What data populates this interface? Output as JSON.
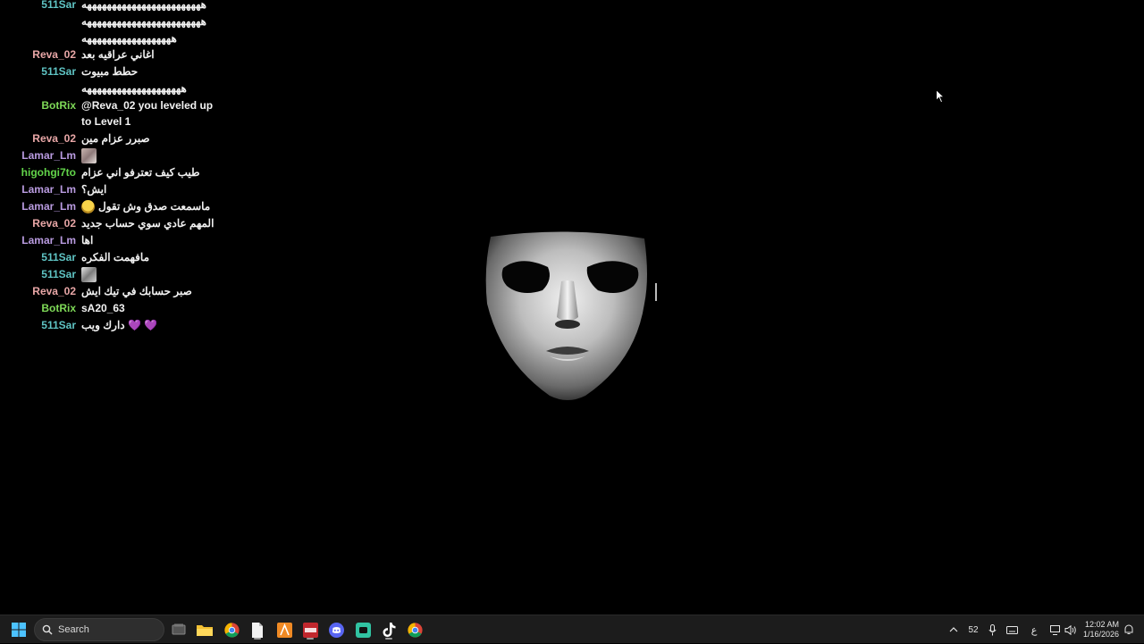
{
  "chat": {
    "messages": [
      {
        "user": "511Sar",
        "color": "#5fc4c4",
        "text": "ههههههههههههههههههههههههه"
      },
      {
        "user": "",
        "color": "#5fc4c4",
        "text": "ههههههههههههههههههههههههه"
      },
      {
        "user": "",
        "color": "#5fc4c4",
        "text": "ههههههههههههههههههه"
      },
      {
        "user": "Reva_02",
        "color": "#e9a7a7",
        "text": "اغاني عراقيه بعد"
      },
      {
        "user": "511Sar",
        "color": "#5fc4c4",
        "text": "حطط مبيوت"
      },
      {
        "user": "",
        "color": "#5fc4c4",
        "text": "ههههههههههههههههههههه"
      },
      {
        "user": "BotRix",
        "color": "#7ed957",
        "text": "@Reva_02 you leveled up to Level 1"
      },
      {
        "user": "Reva_02",
        "color": "#e9a7a7",
        "text": "صبرر عزام مين"
      },
      {
        "user": "Lamar_Lm",
        "color": "#b99be0",
        "text": "",
        "emote": "photo-emote"
      },
      {
        "user": "higohgi7to",
        "color": "#62d44a",
        "text": "طيب كيف تعترفو اني عزام"
      },
      {
        "user": "Lamar_Lm",
        "color": "#b99be0",
        "text": "ايش؟"
      },
      {
        "user": "Lamar_Lm",
        "color": "#b99be0",
        "text": "ماسمعت صدق وش تقول",
        "emote": "face-emote"
      },
      {
        "user": "Reva_02",
        "color": "#e9a7a7",
        "text": "المهم عادي سوي حساب جديد"
      },
      {
        "user": "Lamar_Lm",
        "color": "#b99be0",
        "text": "اها"
      },
      {
        "user": "511Sar",
        "color": "#5fc4c4",
        "text": "مافهمت الفكره"
      },
      {
        "user": "511Sar",
        "color": "#5fc4c4",
        "text": "",
        "emote": "photo2-emote"
      },
      {
        "user": "Reva_02",
        "color": "#e9a7a7",
        "text": "صبر حسابك في تيك ايش"
      },
      {
        "user": "BotRix",
        "color": "#7ed957",
        "text": "sA20_63"
      },
      {
        "user": "511Sar",
        "color": "#5fc4c4",
        "text": "💜 💜 دارك ويب"
      }
    ]
  },
  "taskbar": {
    "search_placeholder": "Search",
    "apps": [
      {
        "name": "windows-start-icon"
      },
      {
        "name": "task-view-icon"
      },
      {
        "name": "file-explorer-icon"
      },
      {
        "name": "chrome-icon"
      },
      {
        "name": "notepad-icon"
      },
      {
        "name": "app-orange-icon"
      },
      {
        "name": "voicemod-icon"
      },
      {
        "name": "discord-icon"
      },
      {
        "name": "streamlabs-icon"
      },
      {
        "name": "tiktok-live-icon"
      },
      {
        "name": "chrome-profile-icon"
      }
    ],
    "tray": {
      "badge_count": "52",
      "language": "ع",
      "time": "12:02 AM",
      "date": "1/16/2026"
    }
  },
  "colors": {
    "background": "#000000",
    "taskbar": "#1c1c1c"
  }
}
